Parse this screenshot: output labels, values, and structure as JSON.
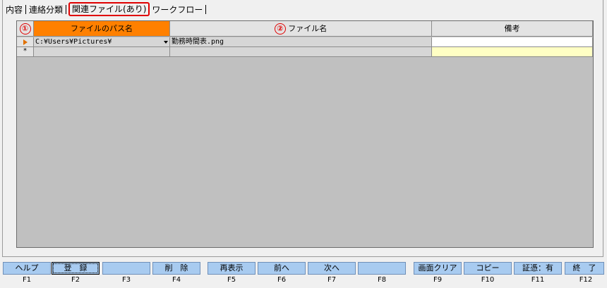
{
  "tabs": [
    {
      "label": "内容"
    },
    {
      "label": "連絡分類"
    },
    {
      "label": "関連ファイル(あり)",
      "active": true
    },
    {
      "label": "ワークフロー"
    }
  ],
  "grid": {
    "columns": [
      {
        "marker": "①",
        "label": "ファイルのパス名"
      },
      {
        "marker": "②",
        "label": "ファイル名"
      },
      {
        "label": "備考"
      }
    ],
    "rows": [
      {
        "selector": "current",
        "path": "C:¥Users¥Pictures¥ ",
        "filename": "勤務時間表.png",
        "note": ""
      }
    ],
    "new_row_marker": "*"
  },
  "fkeys": [
    {
      "label": "ヘルプ",
      "key": "F1"
    },
    {
      "label": "登　録",
      "key": "F2"
    },
    {
      "label": "",
      "key": "F3"
    },
    {
      "label": "削　除",
      "key": "F4"
    },
    {
      "label": "再表示",
      "key": "F5"
    },
    {
      "label": "前へ",
      "key": "F6"
    },
    {
      "label": "次へ",
      "key": "F7"
    },
    {
      "label": "",
      "key": "F8"
    },
    {
      "label": "画面クリア",
      "key": "F9"
    },
    {
      "label": "コピー",
      "key": "F10"
    },
    {
      "label": "証憑：有",
      "key": "F11"
    },
    {
      "label": "終　了",
      "key": "F12"
    }
  ],
  "colors": {
    "header_highlight": "#ff8000",
    "annotation_red": "#e00000",
    "fkey_blue": "#a8cbf0",
    "new_row_yellow": "#ffffc4"
  }
}
